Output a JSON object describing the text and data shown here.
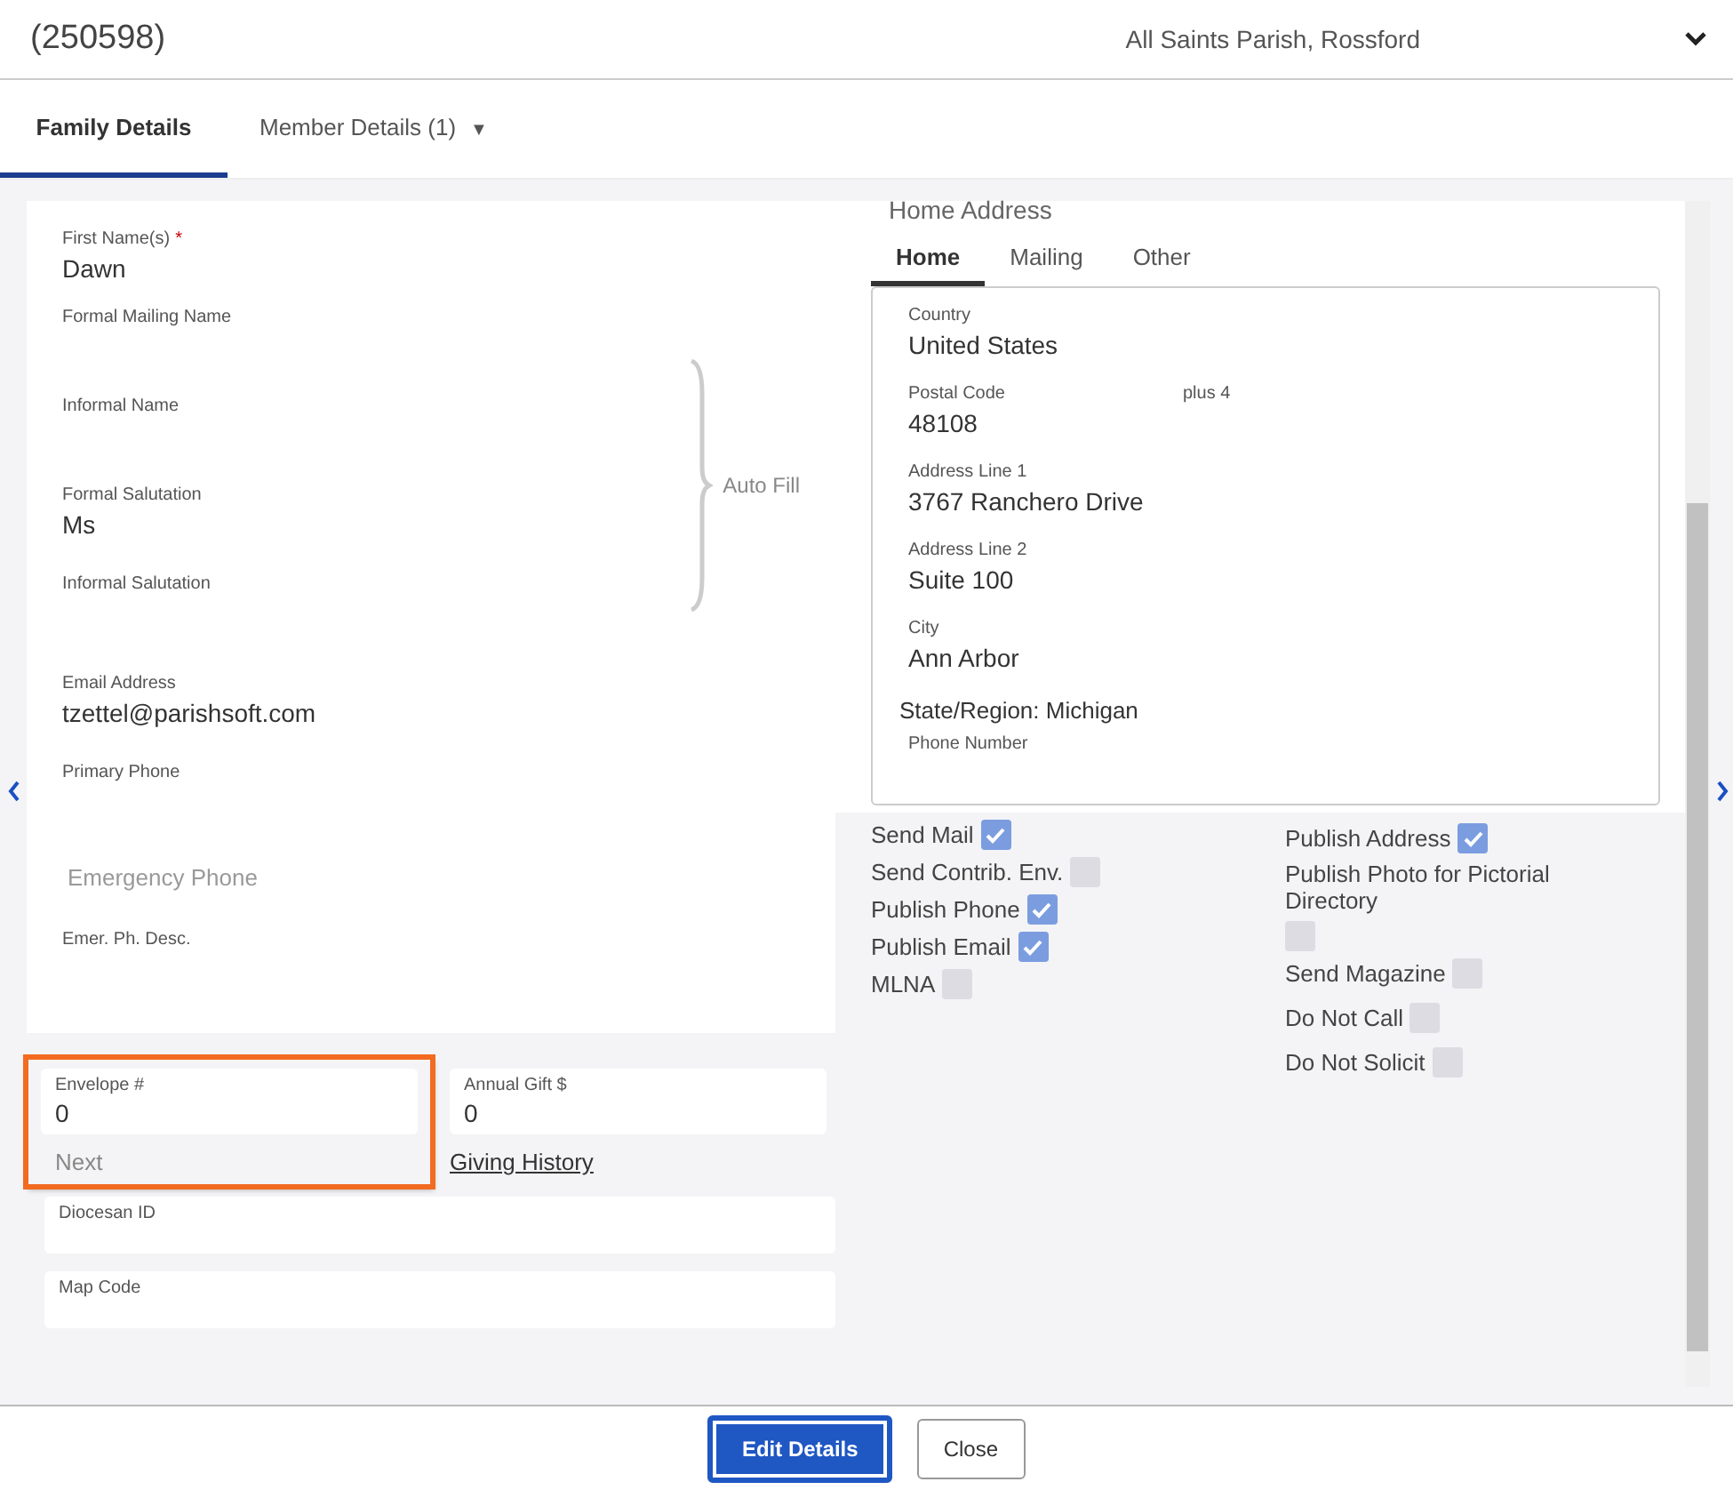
{
  "header": {
    "record_id": "(250598)",
    "parish": "All Saints Parish, Rossford"
  },
  "tabs": [
    {
      "label": "Family Details",
      "selected": true
    },
    {
      "label": "Member Details (1)",
      "selected": false,
      "menu_icon": "▼"
    }
  ],
  "name_fields": [
    {
      "label": "First Name(s)",
      "value": "Dawn",
      "required_mark": "*"
    }
  ],
  "auto_fill": {
    "label": "Auto Fill",
    "fields": [
      {
        "label": "Formal Mailing Name"
      },
      {
        "label": "Informal Name"
      },
      {
        "label": "Formal Salutation",
        "value": "Ms"
      },
      {
        "label": "Informal Salutation"
      }
    ]
  },
  "contact_fields": [
    {
      "kind": "field",
      "label": "Email Address",
      "value": "tzettel@parishsoft.com"
    },
    {
      "kind": "field",
      "label": "Primary Phone"
    },
    {
      "kind": "placeholder",
      "label": "Emergency Phone"
    },
    {
      "kind": "field",
      "label": "Emer. Ph. Desc."
    }
  ],
  "envelope": {
    "label": "Envelope #",
    "value": "0",
    "next": "Next",
    "highlighted": true
  },
  "annual_gift": {
    "label": "Annual Gift $",
    "value": "0",
    "link": "Giving History"
  },
  "lower_fields": [
    {
      "label": "Diocesan ID"
    },
    {
      "label": "Map Code"
    }
  ],
  "address": {
    "heading": "Home Address",
    "tabs": [
      {
        "label": "Home",
        "selected": true
      },
      {
        "label": "Mailing",
        "selected": false
      },
      {
        "label": "Other",
        "selected": false
      }
    ],
    "fields": [
      {
        "label": "Country",
        "value": "United States"
      },
      {
        "label": "Postal Code",
        "value": "48108",
        "extra_label": "plus 4"
      },
      {
        "label": "Address Line 1",
        "value": "3767 Ranchero Drive"
      },
      {
        "label": "Address Line 2",
        "value": "Suite 100"
      },
      {
        "label": "City",
        "value": "Ann Arbor"
      }
    ],
    "state_line": "State/Region: Michigan",
    "phone_label": "Phone Number"
  },
  "options_left": [
    {
      "label": "Send Mail",
      "checked": true
    },
    {
      "label": "Send Contrib. Env.",
      "checked": false
    },
    {
      "label": "Publish Phone",
      "checked": true
    },
    {
      "label": "Publish Email",
      "checked": true
    },
    {
      "label": "MLNA",
      "checked": false
    }
  ],
  "options_right": [
    {
      "label": "Publish Address",
      "checked": true
    },
    {
      "label": "Publish Photo for Pictorial Directory",
      "checked": false
    },
    {
      "label": "Send Magazine",
      "checked": false
    },
    {
      "label": "Do Not Call",
      "checked": false
    },
    {
      "label": "Do Not Solicit",
      "checked": false
    }
  ],
  "buttons": [
    {
      "label": "Edit Details",
      "kind": "primary",
      "highlighted": true
    },
    {
      "label": "Close",
      "kind": "secondary",
      "highlighted": false
    }
  ]
}
